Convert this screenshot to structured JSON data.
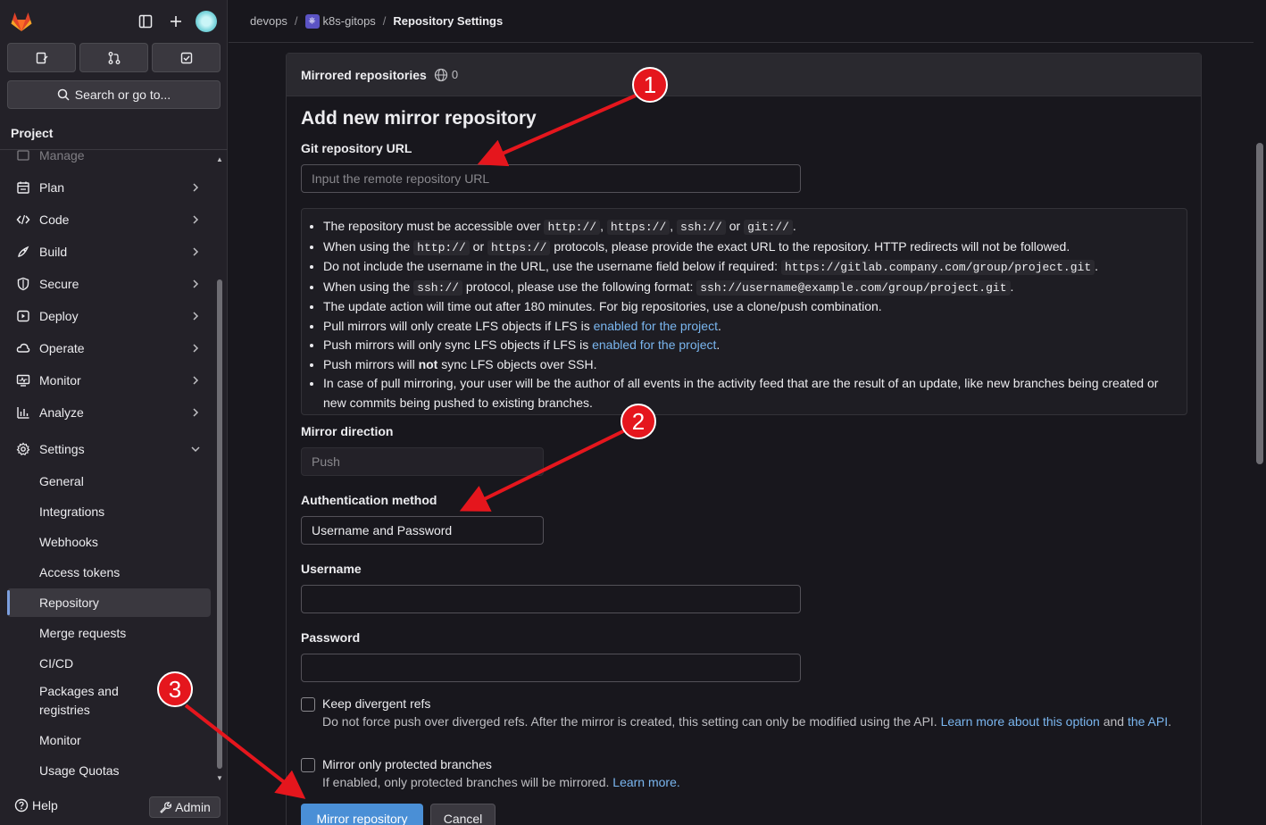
{
  "sidebar": {
    "project_label": "Project",
    "search_label": "Search or go to...",
    "partial_item": "Manage",
    "nav": [
      {
        "label": "Plan",
        "icon": "plan-icon"
      },
      {
        "label": "Code",
        "icon": "code-icon"
      },
      {
        "label": "Build",
        "icon": "rocket-icon"
      },
      {
        "label": "Secure",
        "icon": "shield-icon"
      },
      {
        "label": "Deploy",
        "icon": "deploy-icon"
      },
      {
        "label": "Operate",
        "icon": "cloud-icon"
      },
      {
        "label": "Monitor",
        "icon": "monitor-icon"
      },
      {
        "label": "Analyze",
        "icon": "chart-icon"
      },
      {
        "label": "Settings",
        "icon": "gear-icon"
      }
    ],
    "settings_sub": [
      "General",
      "Integrations",
      "Webhooks",
      "Access tokens",
      "Repository",
      "Merge requests",
      "CI/CD",
      "Packages and registries",
      "Monitor",
      "Usage Quotas"
    ],
    "help_label": "Help",
    "admin_label": "Admin"
  },
  "breadcrumb": {
    "group": "devops",
    "project": "k8s-gitops",
    "current": "Repository Settings"
  },
  "card": {
    "header_title": "Mirrored repositories",
    "header_count": "0",
    "title": "Add new mirror repository",
    "url_label": "Git repository URL",
    "url_placeholder": "Input the remote repository URL",
    "info": {
      "l1_a": "The repository must be accessible over ",
      "l1_c1": "http://",
      "l1_s1": ", ",
      "l1_c2": "https://",
      "l1_s2": ", ",
      "l1_c3": "ssh://",
      "l1_s3": " or ",
      "l1_c4": "git://",
      "l1_end": ".",
      "l2_a": "When using the ",
      "l2_c1": "http://",
      "l2_s1": " or ",
      "l2_c2": "https://",
      "l2_b": " protocols, please provide the exact URL to the repository. HTTP redirects will not be followed.",
      "l3_a": "Do not include the username in the URL, use the username field below if required: ",
      "l3_c": "https://gitlab.company.com/group/project.git",
      "l3_end": ".",
      "l4_a": "When using the ",
      "l4_c1": "ssh://",
      "l4_b": " protocol, please use the following format: ",
      "l4_c2": "ssh://username@example.com/group/project.git",
      "l4_end": ".",
      "l5": "The update action will time out after 180 minutes. For big repositories, use a clone/push combination.",
      "l6_a": "Pull mirrors will only create LFS objects if LFS is ",
      "l6_link": "enabled for the project",
      "l6_end": ".",
      "l7_a": "Push mirrors will only sync LFS objects if LFS is ",
      "l7_link": "enabled for the project",
      "l7_end": ".",
      "l8_a": "Push mirrors will ",
      "l8_b": "not",
      "l8_c": " sync LFS objects over SSH.",
      "l9": "In case of pull mirroring, your user will be the author of all events in the activity feed that are the result of an update, like new branches being created or new commits being pushed to existing branches."
    },
    "direction_label": "Mirror direction",
    "direction_value": "Push",
    "auth_label": "Authentication method",
    "auth_value": "Username and Password",
    "username_label": "Username",
    "password_label": "Password",
    "keep_divergent_label": "Keep divergent refs",
    "keep_divergent_help": "Do not force push over diverged refs. After the mirror is created, this setting can only be modified using the API. ",
    "keep_divergent_link1": "Learn more about this option",
    "keep_divergent_and": " and ",
    "keep_divergent_link2": "the API",
    "keep_divergent_end": ".",
    "protected_label": "Mirror only protected branches",
    "protected_help": "If enabled, only protected branches will be mirrored. ",
    "protected_link": "Learn more.",
    "submit_label": "Mirror repository",
    "cancel_label": "Cancel"
  },
  "annotations": [
    "1",
    "2",
    "3"
  ],
  "colors": {
    "accent": "#4a8fd6",
    "link": "#7ab6ef",
    "annotation": "#e5161d"
  }
}
